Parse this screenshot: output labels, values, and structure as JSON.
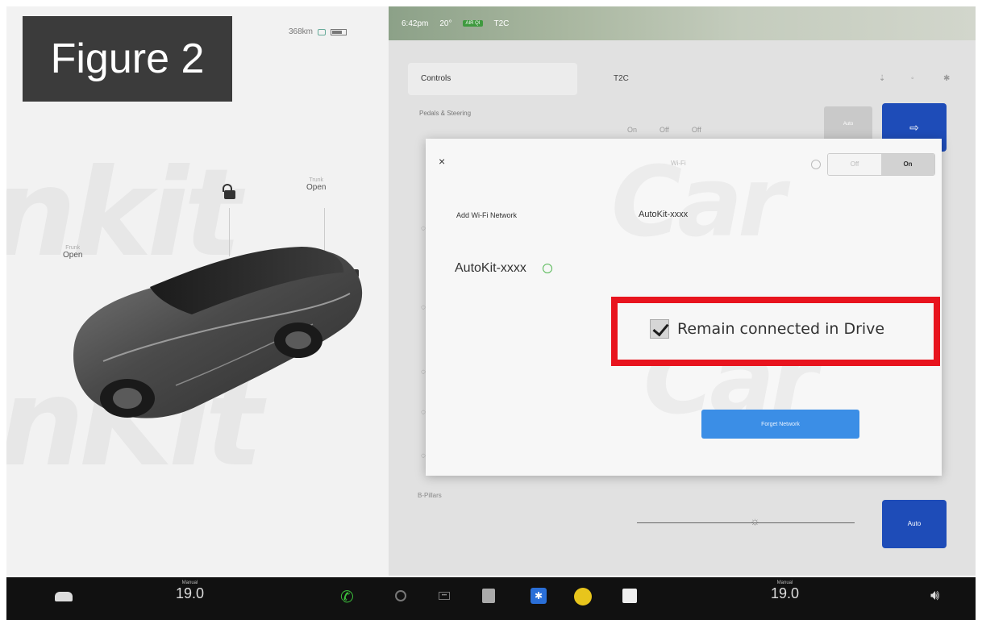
{
  "figure_label": "Figure 2",
  "left_panel": {
    "status_range": "368km",
    "frunk": {
      "label": "Frunk",
      "action": "Open"
    },
    "trunk": {
      "label": "Trunk",
      "action": "Open"
    }
  },
  "top_bar": {
    "time": "6:42pm",
    "temperature": "20°",
    "temp_badge": "AIR QI",
    "profile": "T2C"
  },
  "settings": {
    "controls_tab": "Controls",
    "profile_name": "T2C",
    "menu_first": "Pedals & Steering",
    "b_pillar": "B-Pillars",
    "pedal_options": [
      "On",
      "Off",
      "Off"
    ],
    "gray_chip": "Auto",
    "auto_button": "Auto"
  },
  "wifi_modal": {
    "close_label": "×",
    "title": "Wi-Fi",
    "toggle_off": "Off",
    "toggle_on": "On",
    "add_network_label": "Add Wi-Fi Network",
    "network_field_value": "AutoKit-xxxx",
    "current_network": "AutoKit-xxxx",
    "remain_connected_label": "Remain connected in Drive",
    "remain_connected_checked": true,
    "forget_button": "Forget Network"
  },
  "dock": {
    "left_temp_mode": "Manual",
    "left_temp": "19.0",
    "right_temp_mode": "Manual",
    "right_temp": "19.0"
  },
  "colors": {
    "highlight_box": "#e8141e",
    "accent_blue": "#1e4cb8",
    "forget_button": "#3b8ee6"
  },
  "icons": [
    "car-icon",
    "phone-icon",
    "camera-icon",
    "dots-icon",
    "calendar-icon",
    "bluetooth-icon",
    "toybox-icon",
    "notes-icon",
    "volume-icon",
    "lock-icon",
    "charge-port-icon"
  ]
}
